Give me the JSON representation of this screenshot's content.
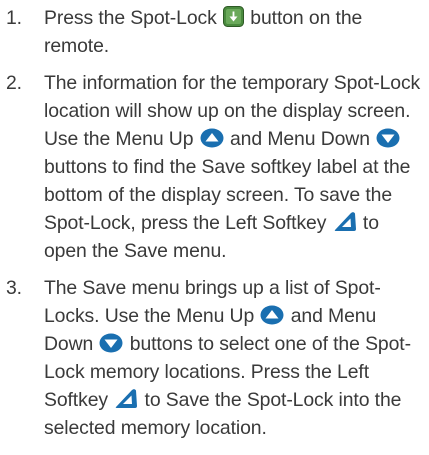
{
  "steps": [
    {
      "number": "1.",
      "parts": [
        {
          "text": "Press the Spot-Lock "
        },
        {
          "icon": "spot-lock-button-icon"
        },
        {
          "text": " button on the remote."
        }
      ]
    },
    {
      "number": "2.",
      "parts": [
        {
          "text": "The information for the temporary Spot-Lock location will show up on the display screen. Use the Menu Up "
        },
        {
          "icon": "menu-up-icon"
        },
        {
          "text": " and Menu Down "
        },
        {
          "icon": "menu-down-icon"
        },
        {
          "text": " buttons to find the Save softkey label at the bottom of the display screen. To save the Spot-Lock, press the Left Softkey "
        },
        {
          "icon": "left-softkey-icon"
        },
        {
          "text": " to open the Save menu."
        }
      ]
    },
    {
      "number": "3.",
      "parts": [
        {
          "text": "The Save menu brings up a list of Spot-Locks. Use the Menu Up "
        },
        {
          "icon": "menu-up-icon"
        },
        {
          "text": " and Menu Down "
        },
        {
          "icon": "menu-down-icon"
        },
        {
          "text": " buttons to select one of the Spot-Lock memory locations. Press the Left Softkey "
        },
        {
          "icon": "left-softkey-icon"
        },
        {
          "text": " to Save the Spot-Lock into the selected memory location."
        }
      ]
    }
  ],
  "colors": {
    "text": "#3a3a3a",
    "spot_lock_button": "#4a8a3e",
    "menu_button": "#1a6fb0",
    "softkey_button": "#1a6fb0"
  }
}
